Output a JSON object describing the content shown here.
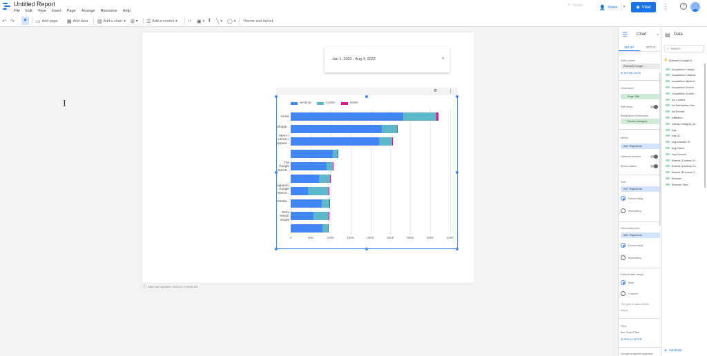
{
  "app": {
    "title": "Untitled Report"
  },
  "menu": [
    "File",
    "Edit",
    "View",
    "Insert",
    "Page",
    "Arrange",
    "Resource",
    "Help"
  ],
  "header": {
    "reset": "Reset",
    "share": "Share",
    "view": "View"
  },
  "toolbar": {
    "add_page": "Add page",
    "add_data": "Add data",
    "add_chart": "Add a chart",
    "add_control": "Add a control",
    "theme": "Theme and layout"
  },
  "date_control": {
    "value": "Jan 1, 2022 - Aug 4, 2022"
  },
  "last_updated": "Data Last Updated: 8/4/2022 3:56:55 AM",
  "chart_data": {
    "type": "bar",
    "orientation": "horizontal",
    "stacked": true,
    "categories": [
      "Home",
      "Shoppi...",
      "Men's / Unisex | Appare...",
      "",
      "The Google Merch...",
      "",
      "Apparel | Google Merch...",
      "Drinkw...",
      "Store search results",
      ""
    ],
    "series": [
      {
        "name": "desktop",
        "color": "#4285f4",
        "values": [
          282000,
          228000,
          222000,
          105000,
          90000,
          71000,
          44000,
          78000,
          58000,
          80000
        ]
      },
      {
        "name": "mobile",
        "color": "#5bb8c9",
        "values": [
          84000,
          38000,
          32000,
          12000,
          16000,
          27000,
          51000,
          19000,
          37000,
          13000
        ]
      },
      {
        "name": "tablet",
        "color": "#d81b8a",
        "values": [
          4000,
          2000,
          2000,
          1000,
          1000,
          1000,
          2000,
          1000,
          1000,
          1000
        ]
      }
    ],
    "x_ticks": [
      "0",
      "50K",
      "100K",
      "150K",
      "200K",
      "250K",
      "300K",
      "350K",
      "400K"
    ],
    "xlim": [
      0,
      400000
    ],
    "legend_position": "top-left",
    "grid": true
  },
  "chart_panel": {
    "title": "Chart",
    "tabs": [
      "SETUP",
      "STYLE"
    ],
    "data_source_label": "Data source",
    "data_source": "[Sample] Google ...",
    "blend": "BLEND DATA",
    "dimension_label": "Dimension",
    "dimension": "Page Title",
    "drill_down": "Drill down",
    "breakdown_label": "Breakdown Dimension",
    "breakdown": "Device Category",
    "metric_label": "Metric",
    "metric": "Pageviews",
    "metric_type": "AUT",
    "optional_metrics": "Optional metrics",
    "metric_sliders": "Metric sliders",
    "sort_label": "Sort",
    "sort": "Pageviews",
    "descending": "Descending",
    "ascending": "Ascending",
    "secondary_sort_label": "Secondary sort",
    "secondary_sort": "Pageviews",
    "date_range_label": "Default date range",
    "auto": "Auto",
    "custom": "Custom",
    "date_note": "This year to date (include today)",
    "filter_label": "Filter",
    "bar_filter": "Bar Chart Filter",
    "add_filter": "ADD A FILTER",
    "segment": "Google Analytics segment"
  },
  "data_panel": {
    "title": "Data",
    "search_placeholder": "Search",
    "source": "[Sample] Google A...",
    "fields": [
      "Acquisition Campa...",
      "Acquisition Channel",
      "Acquisition Medium",
      "Acquisition Source",
      "Acquisition Source ...",
      "Ad Content",
      "Ad Distribution Net...",
      "Ad Format",
      "Affiliation",
      "Affinity Category (re...",
      "Age",
      "App ID",
      "App Installer ID",
      "App Name",
      "App Version",
      "Brands (Content Gr...",
      "Brands (Landing Co...",
      "Brands (Previous C...",
      "Browser",
      "Browser Size"
    ],
    "add_data": "Add Data"
  }
}
